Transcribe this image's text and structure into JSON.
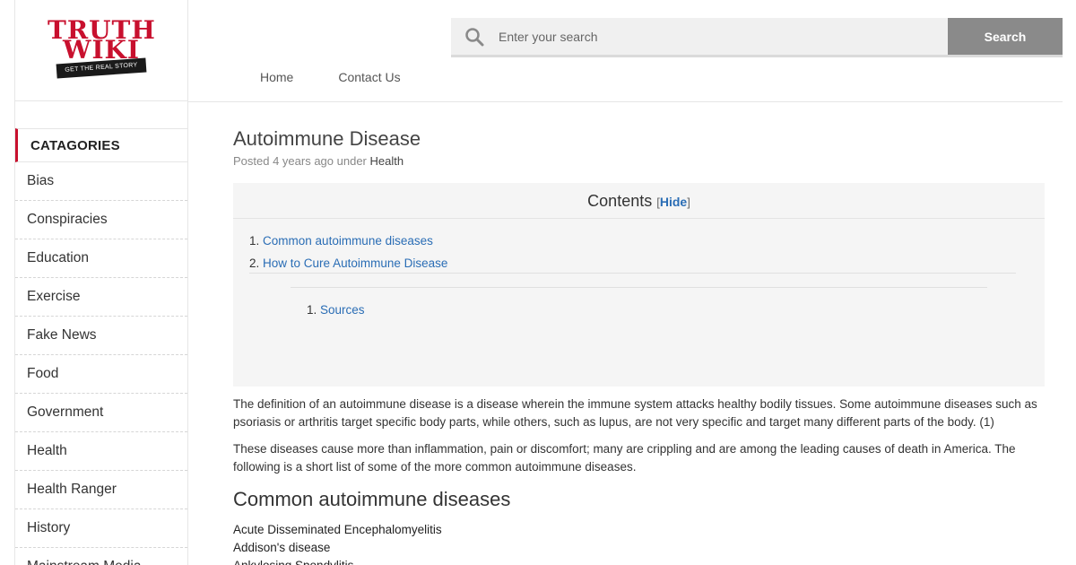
{
  "logo": {
    "line1": "TRUTH",
    "line2": "WIKI",
    "tagline": "GET THE REAL STORY",
    "brand_color": "#c8102e"
  },
  "search": {
    "placeholder": "Enter your search",
    "button_label": "Search",
    "icon": "search-icon"
  },
  "nav": {
    "items": [
      "Home",
      "Contact Us"
    ]
  },
  "sidebar": {
    "header": "CATAGORIES",
    "items": [
      "Bias",
      "Conspiracies",
      "Education",
      "Exercise",
      "Fake News",
      "Food",
      "Government",
      "Health",
      "Health Ranger",
      "History",
      "Mainstream Media"
    ]
  },
  "article": {
    "title": "Autoimmune Disease",
    "meta_prefix": "Posted 4 years ago under",
    "meta_category": "Health",
    "toc": {
      "title": "Contents",
      "bracket_open": "[",
      "hide_label": "Hide",
      "bracket_close": "]",
      "items": [
        {
          "num": "1.",
          "label": "Common autoimmune diseases"
        },
        {
          "num": "2.",
          "label": "How to Cure Autoimmune Disease"
        }
      ],
      "subitems": [
        {
          "num": "1.",
          "label": "Sources"
        }
      ]
    },
    "paragraphs": [
      "The definition of an autoimmune disease is a disease wherein the immune system attacks healthy bodily tissues. Some autoimmune diseases such as psoriasis or arthritis target specific body parts, while others, such as lupus, are not very specific and target many different parts of the body. (1)",
      "These diseases cause more than inflammation, pain or discomfort; many are crippling and are among the leading causes of death in America. The following is a short list of some of the more common autoimmune diseases."
    ],
    "section_title": "Common autoimmune diseases",
    "diseases": [
      "Acute Disseminated Encephalomyelitis",
      "Addison's disease",
      "Ankylosing Spondylitis"
    ]
  },
  "colors": {
    "link": "#2a6db5",
    "search_button": "#8a8a8a",
    "accent": "#c8102e"
  }
}
